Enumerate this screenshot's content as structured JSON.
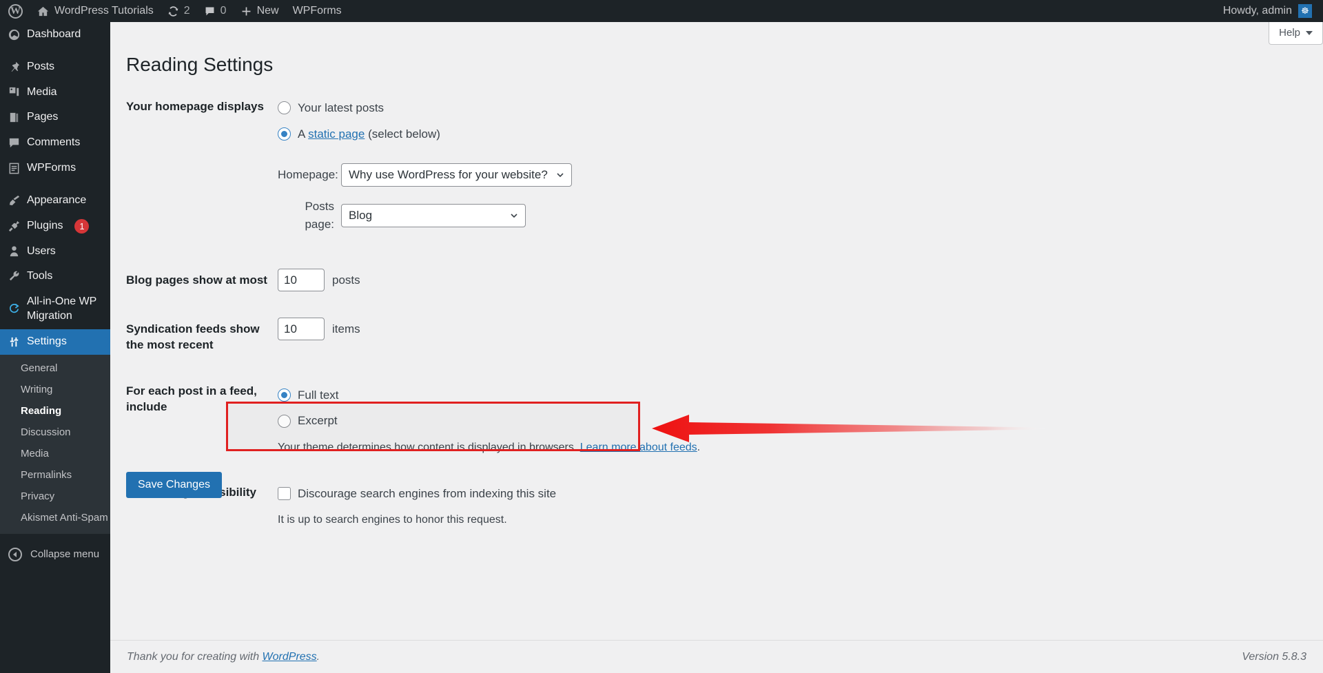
{
  "adminbar": {
    "wp_logo": "wordpress-logo-icon",
    "site_name": "WordPress Tutorials",
    "updates_count": "2",
    "comments_count": "0",
    "new_label": "New",
    "wpforms_label": "WPForms",
    "howdy": "Howdy, admin"
  },
  "sidebar": {
    "items": [
      {
        "label": "Dashboard",
        "icon": "dashboard-icon",
        "badge": ""
      },
      {
        "label": "Posts",
        "icon": "pin-icon",
        "badge": ""
      },
      {
        "label": "Media",
        "icon": "media-icon",
        "badge": ""
      },
      {
        "label": "Pages",
        "icon": "page-icon",
        "badge": ""
      },
      {
        "label": "Comments",
        "icon": "comment-icon",
        "badge": ""
      },
      {
        "label": "WPForms",
        "icon": "wpforms-icon",
        "badge": ""
      },
      {
        "label": "Appearance",
        "icon": "brush-icon",
        "badge": ""
      },
      {
        "label": "Plugins",
        "icon": "plugin-icon",
        "badge": "1"
      },
      {
        "label": "Users",
        "icon": "user-icon",
        "badge": ""
      },
      {
        "label": "Tools",
        "icon": "wrench-icon",
        "badge": ""
      },
      {
        "label": "All-in-One WP Migration",
        "icon": "migration-icon",
        "badge": ""
      },
      {
        "label": "Settings",
        "icon": "settings-icon",
        "badge": ""
      }
    ],
    "submenu": [
      "General",
      "Writing",
      "Reading",
      "Discussion",
      "Media",
      "Permalinks",
      "Privacy",
      "Akismet Anti-Spam"
    ],
    "submenu_current": "Reading",
    "collapse_label": "Collapse menu"
  },
  "content": {
    "page_title": "Reading Settings",
    "help_label": "Help",
    "homepage_displays": {
      "label": "Your homepage displays",
      "option_latest": "Your latest posts",
      "option_static_prefix": "A ",
      "option_static_link": "static page",
      "option_static_suffix": " (select below)",
      "homepage_select_label": "Homepage:",
      "homepage_select_value": "Why use WordPress for your website?",
      "posts_select_label": "Posts page:",
      "posts_select_value": "Blog"
    },
    "blog_pages": {
      "label": "Blog pages show at most",
      "value": "10",
      "unit": "posts"
    },
    "syndication": {
      "label": "Syndication feeds show the most recent",
      "value": "10",
      "unit": "items"
    },
    "feed_include": {
      "label": "For each post in a feed, include",
      "option_full": "Full text",
      "option_excerpt": "Excerpt",
      "hint_text": "Your theme determines how content is displayed in browsers. ",
      "hint_link": "Learn more about feeds",
      "hint_end": "."
    },
    "search_visibility": {
      "label": "Search engine visibility",
      "checkbox_label": "Discourage search engines from indexing this site",
      "note": "It is up to search engines to honor this request."
    },
    "save_label": "Save Changes"
  },
  "footer": {
    "thanks_prefix": "Thank you for creating with ",
    "thanks_link": "WordPress",
    "thanks_end": ".",
    "version": "Version 5.8.3"
  },
  "annotation": {
    "arrow_color": "#ee2222",
    "highlight_color": "#e02020"
  }
}
